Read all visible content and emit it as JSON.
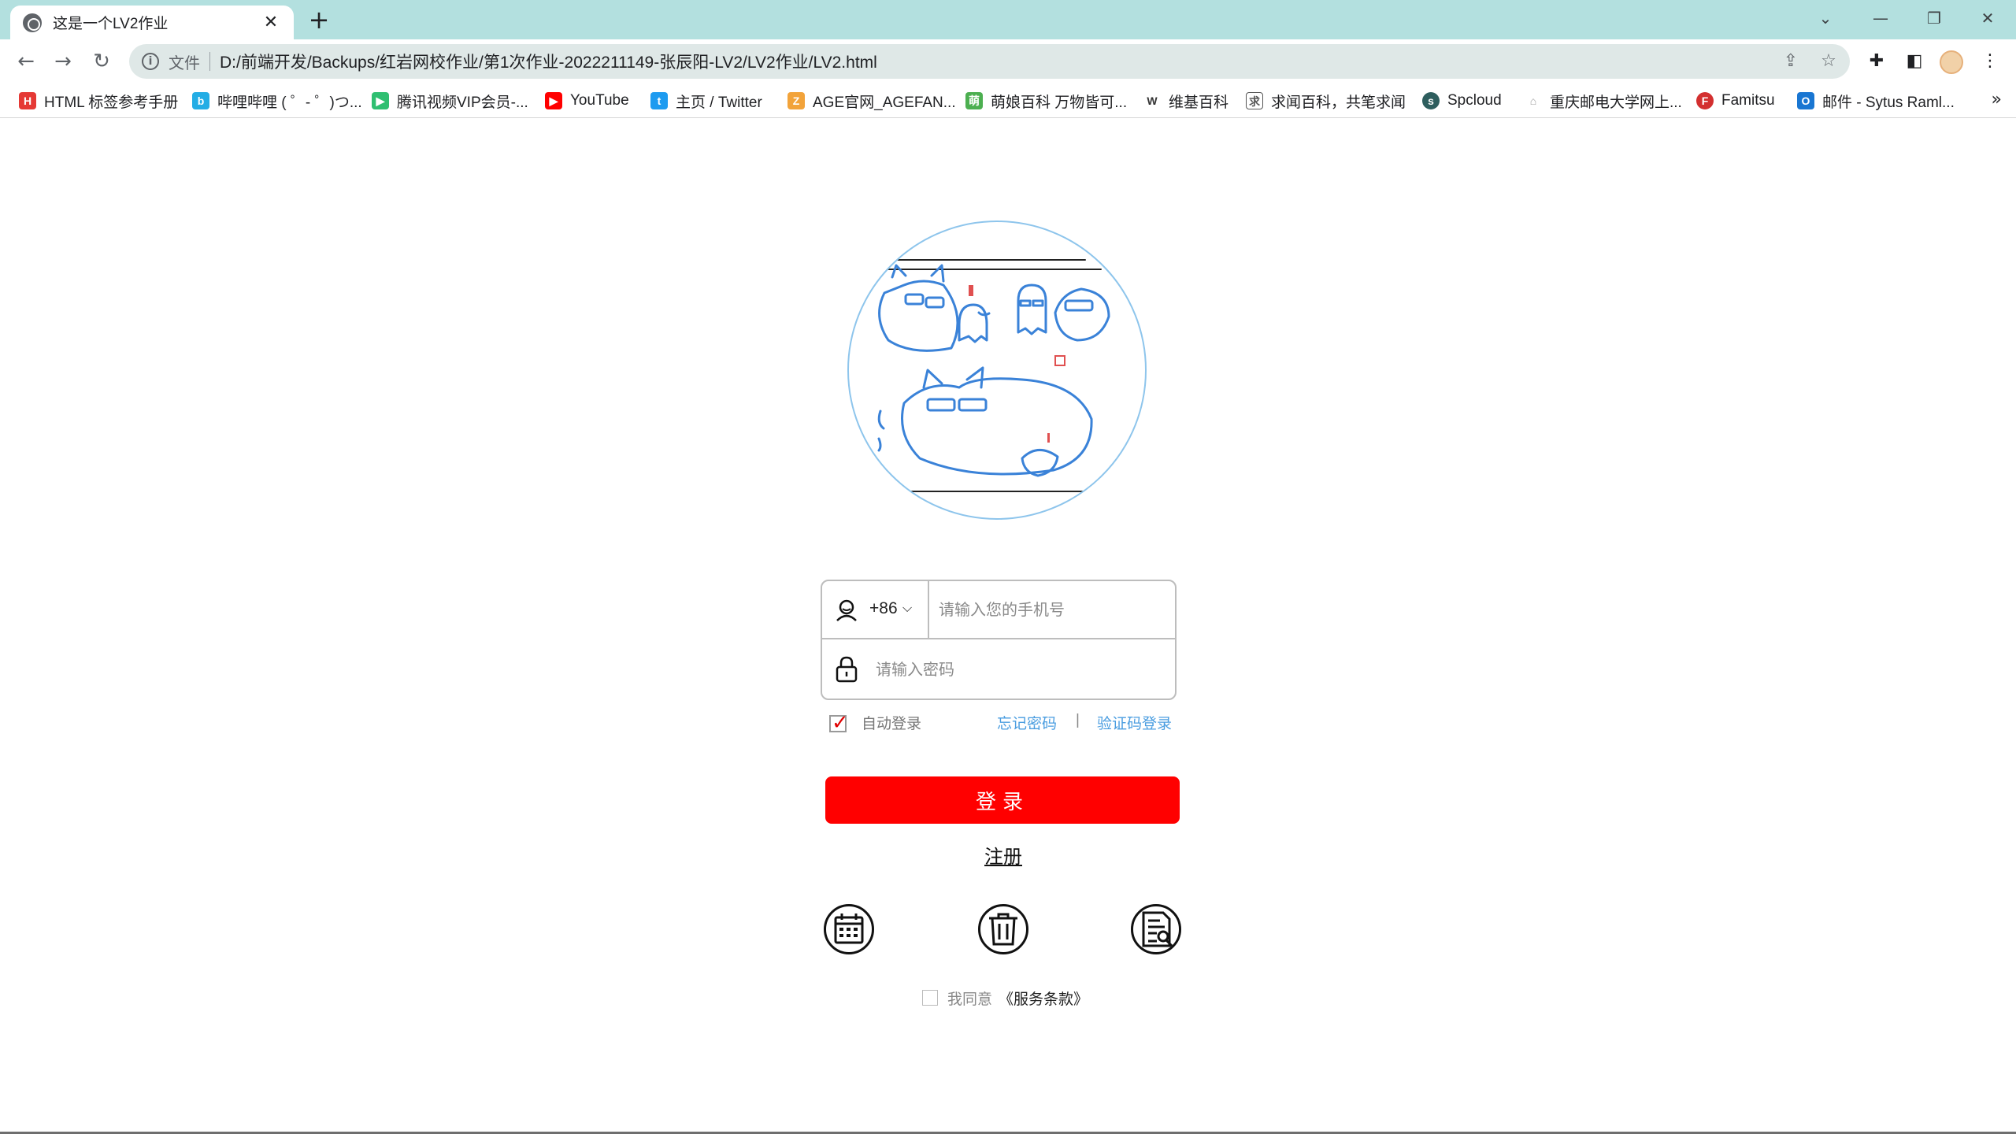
{
  "browser": {
    "tab_title": "这是一个LV2作业",
    "tab_close": "✕",
    "new_tab": "+",
    "file_label": "文件",
    "url": "D:/前端开发/Backups/红岩网校作业/第1次作业-2022211149-张辰阳-LV2/LV2作业/LV2.html",
    "window_controls": {
      "chevron": "⌄",
      "minimize": "—",
      "restore": "❐",
      "close": "✕"
    }
  },
  "bookmarks": [
    {
      "label": "HTML 标签参考手册",
      "icon_color": "#e53935"
    },
    {
      "label": "哔哩哔哩 ( ゜- ゜)つ...",
      "icon_color": "#23ade5"
    },
    {
      "label": "腾讯视频VIP会员-...",
      "icon_color": "#2fbf71"
    },
    {
      "label": "YouTube",
      "icon_color": "#ff0000"
    },
    {
      "label": "主页 / Twitter",
      "icon_color": "#1d9bf0"
    },
    {
      "label": "AGE官网_AGEFAN...",
      "icon_color": "#f2a33a"
    },
    {
      "label": "萌娘百科 万物皆可...",
      "icon_color": "#4caf50"
    },
    {
      "label": "维基百科",
      "icon_color": "#333333"
    },
    {
      "label": "求闻百科，共笔求闻",
      "icon_color": "#555555"
    },
    {
      "label": "Spcloud",
      "icon_color": "#2e5e5e"
    },
    {
      "label": "重庆邮电大学网上...",
      "icon_color": "#9e9e9e"
    },
    {
      "label": "Famitsu",
      "icon_color": "#d32f2f"
    },
    {
      "label": "邮件 - Sytus Raml...",
      "icon_color": "#1976d2"
    }
  ],
  "login": {
    "country_code": "+86",
    "phone_placeholder": "请输入您的手机号",
    "password_placeholder": "请输入密码",
    "auto_login": "自动登录",
    "forgot_password": "忘记密码",
    "separator": "|",
    "sms_login": "验证码登录",
    "login_button": "登录",
    "register": "注册",
    "agree_prefix": "我同意",
    "agree_link": "《服务条款》",
    "auto_login_checked": true,
    "agree_checked": false
  },
  "social_icons": [
    "calendar-icon",
    "trash-icon",
    "document-icon"
  ],
  "colors": {
    "chrome_bg": "#b3e0df",
    "accent_red": "#ff0000",
    "link_blue": "#4a9de0",
    "sketch_blue": "#3a82d8"
  }
}
